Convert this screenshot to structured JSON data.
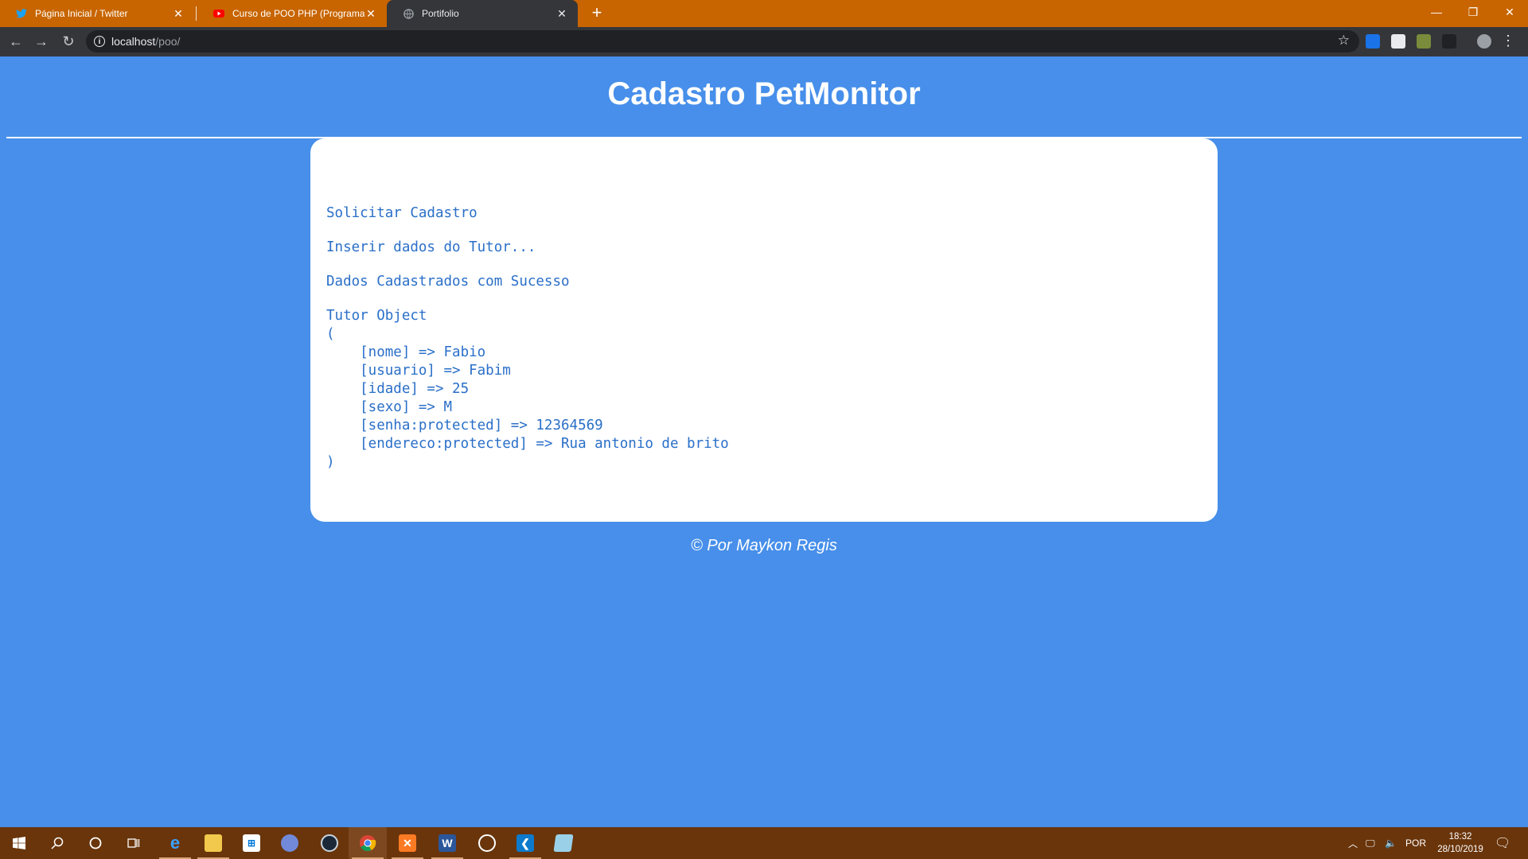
{
  "browser": {
    "tabs": [
      {
        "title": "Página Inicial / Twitter",
        "icon": "twitter-icon"
      },
      {
        "title": "Curso de POO PHP (Programaçã",
        "icon": "youtube-icon"
      },
      {
        "title": "Portifolio",
        "icon": "globe-icon"
      }
    ],
    "url_host": "localhost",
    "url_path": "/poo/"
  },
  "page": {
    "title": "Cadastro PetMonitor",
    "lines": [
      "Solicitar Cadastro",
      "Inserir dados do Tutor...",
      "Dados Cadastrados com Sucesso"
    ],
    "object_dump": "Tutor Object\n(\n    [nome] => Fabio\n    [usuario] => Fabim\n    [idade] => 25\n    [sexo] => M\n    [senha:protected] => 12364569\n    [endereco:protected] => Rua antonio de brito\n)",
    "footer": "© Por Maykon Regis"
  },
  "taskbar": {
    "language": "POR",
    "time": "18:32",
    "date": "28/10/2019"
  },
  "colors": {
    "page_bg": "#478fea",
    "tabstrip_bg": "#c86500",
    "taskbar_bg": "#6a350b",
    "text_blue": "#2a6fc8"
  }
}
